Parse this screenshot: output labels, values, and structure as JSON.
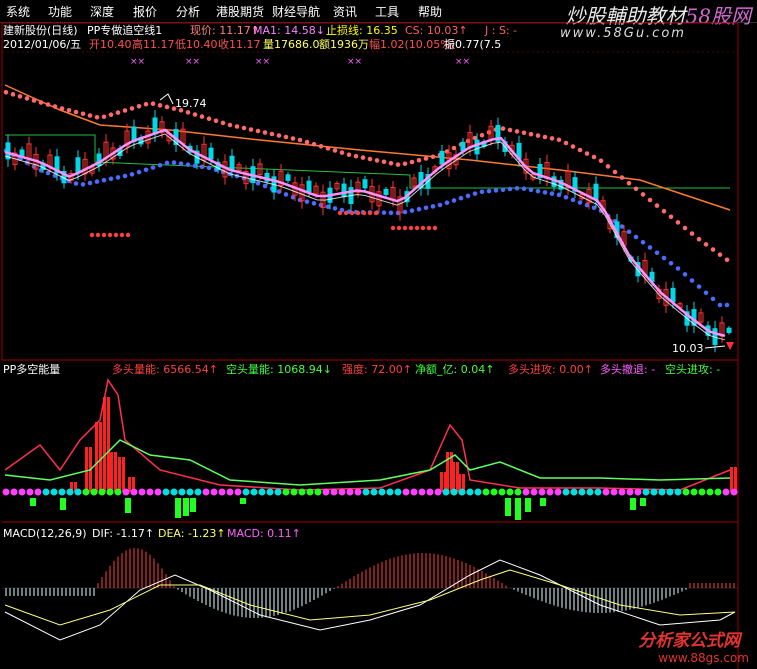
{
  "menu": {
    "items": [
      "系统",
      "功能",
      "深度",
      "报价",
      "分析",
      "港股期货",
      "财经导航",
      "资讯",
      "工具",
      "帮助"
    ]
  },
  "watermark_top": {
    "prefix": "炒股輔助教材",
    "highlight": "58股网",
    "url": "www.58Gu.com"
  },
  "watermark_bottom": {
    "name": "分析家公式网",
    "url": "www.88gs.com"
  },
  "main_panel": {
    "title": "建新股份(日线)",
    "indicator": "PP专做追空线1",
    "price_label": "现价: 11.17↑",
    "ma_label": "MA1: 14.58↓",
    "stop_label": "止损线: 16.35",
    "cs_label": "CS: 10.03↑",
    "extra_label": "J : S: -",
    "date": "2012/01/06/五",
    "open": "开10.40",
    "high": "高11.17",
    "low": "低10.40",
    "close": "收11.17",
    "volume": "量17686.0",
    "amount": "额1936万",
    "change": "幅1.02(10.05%)",
    "amplitude": "振0.77(7.5",
    "peak_price": "19.74",
    "trough_price": "10.03",
    "signal_marks": "××"
  },
  "power_panel": {
    "title": "PP多空能量",
    "long_energy": "多头量能: 6566.54↑",
    "short_energy": "空头量能: 1068.94↓",
    "strength": "强度: 72.00↑",
    "net": "净额_亿: 0.04↑",
    "long_attack": "多头进攻: 0.00↑",
    "long_retreat": "多头撤退: -",
    "short_attack": "空头进攻: -"
  },
  "macd_panel": {
    "title": "MACD(12,26,9)",
    "dif": "DIF: -1.17↑",
    "dea": "DEA: -1.23↑",
    "macd": "MACD: 0.11↑"
  },
  "colors": {
    "up": "#ff3232",
    "down": "#00e0e0",
    "ma_pink": "#ff80ff",
    "red_dot": "#ff6060",
    "blue_dot": "#4060ff",
    "grid": "#a00000",
    "green": "#00ff00",
    "yellow": "#ffff66"
  }
}
